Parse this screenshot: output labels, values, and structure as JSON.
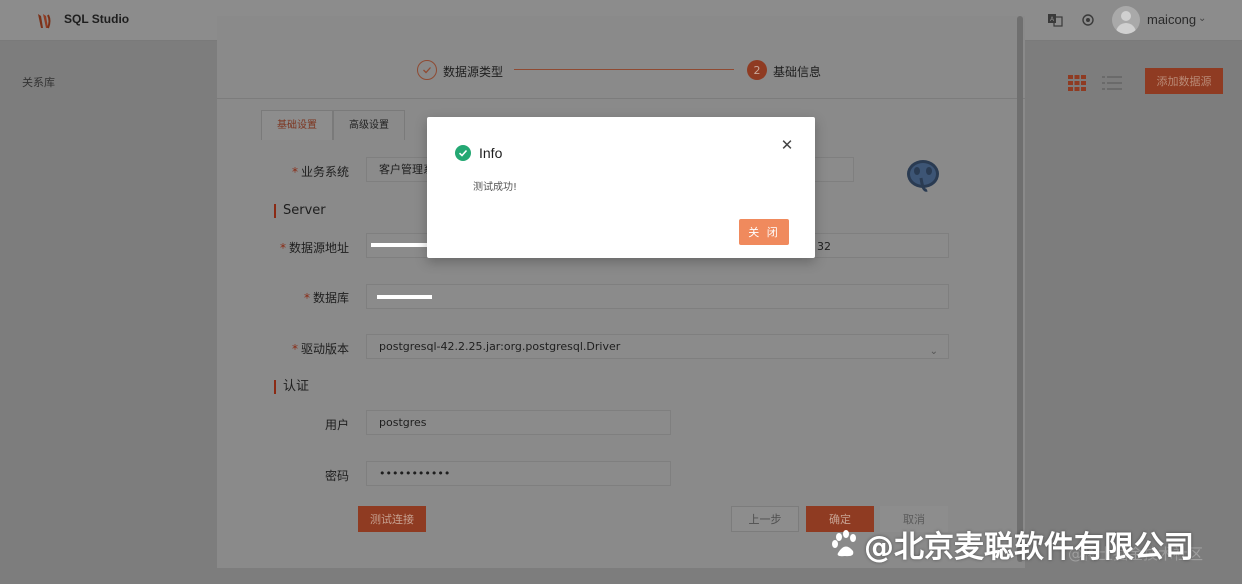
{
  "app": {
    "title": "SQL Studio",
    "username": "maicong",
    "breadcrumb": "关系库",
    "add_datasource_label": "添加数据源"
  },
  "wizard": {
    "steps": [
      {
        "index": "1",
        "label": "数据源类型",
        "state": "done"
      },
      {
        "index": "2",
        "label": "基础信息",
        "state": "active"
      }
    ],
    "tabs": [
      {
        "label": "基础设置",
        "active": true
      },
      {
        "label": "高级设置",
        "active": false
      }
    ]
  },
  "form": {
    "business_system": {
      "label": "业务系统",
      "value": "客户管理系"
    },
    "server_section": "Server",
    "address": {
      "label": "数据源地址",
      "port_partial": "32"
    },
    "database": {
      "label": "数据库"
    },
    "driver": {
      "label": "驱动版本",
      "value": "postgresql-42.2.25.jar:org.postgresql.Driver"
    },
    "auth_section": "认证",
    "user": {
      "label": "用户",
      "value": "postgres"
    },
    "password": {
      "label": "密码",
      "value": "•••••••••••"
    }
  },
  "actions": {
    "test_connection": "测试连接",
    "prev": "上一步",
    "confirm": "确定",
    "cancel": "取消"
  },
  "modal": {
    "title": "Info",
    "message": "测试成功!",
    "close_button": "关 闭",
    "success_color": "#24a873",
    "button_color": "#f08a5d"
  },
  "watermark": {
    "main": "@北京麦聪软件有限公司",
    "secondary": "@稀土掘金技术社区"
  }
}
